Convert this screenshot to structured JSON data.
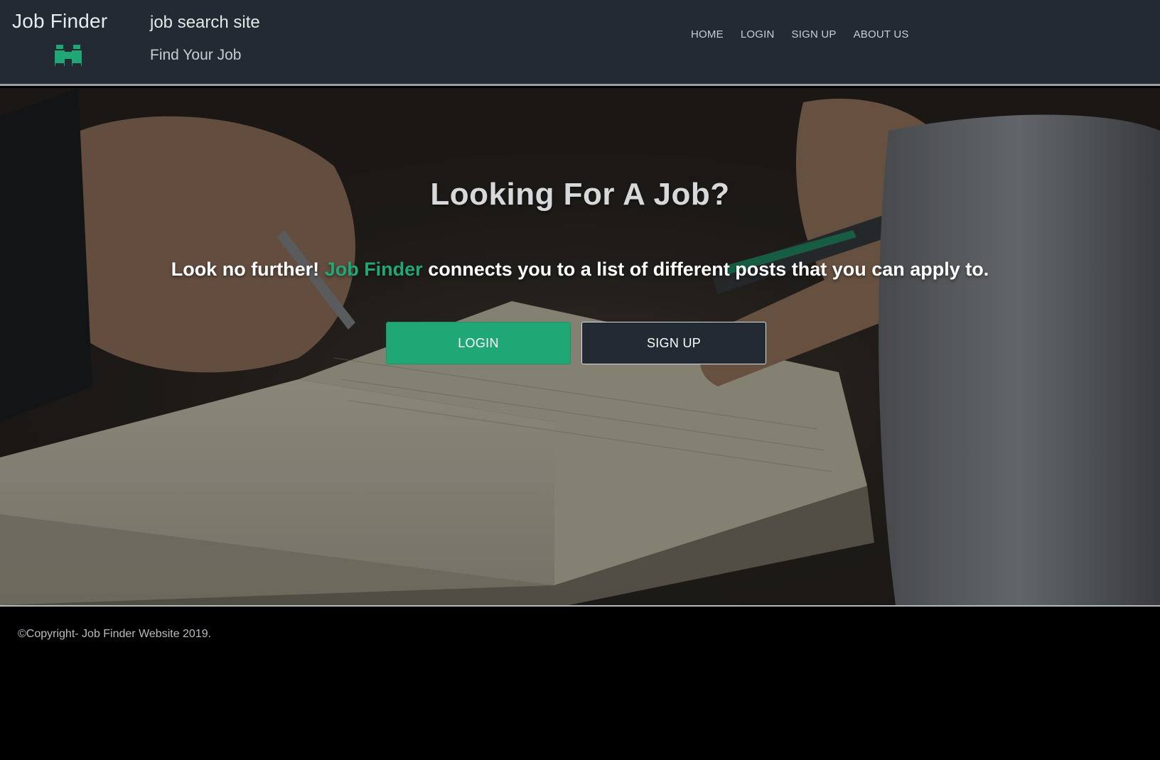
{
  "header": {
    "brand": "Job Finder",
    "brand_icon": "binoculars-icon",
    "tagline_main": "job search site",
    "tagline_sub": "Find Your Job",
    "nav": [
      {
        "label": "HOME"
      },
      {
        "label": "LOGIN"
      },
      {
        "label": "SIGN UP"
      },
      {
        "label": "ABOUT US"
      }
    ]
  },
  "hero": {
    "title": "Looking For A Job?",
    "text_before": "Look no further! ",
    "text_accent": "Job Finder",
    "text_after": " connects you to a list of different posts that you can apply to.",
    "login_label": "LOGIN",
    "signup_label": "SIGN UP"
  },
  "footer": {
    "copyright": "©Copyright- Job Finder Website 2019."
  },
  "colors": {
    "accent": "#1fa876",
    "header_bg": "#232a34",
    "footer_bg": "#000000"
  }
}
